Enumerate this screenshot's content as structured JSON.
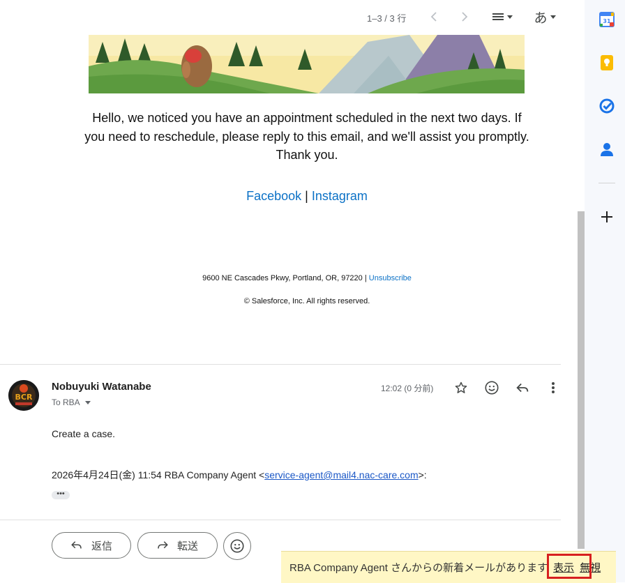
{
  "toolbar": {
    "pager": "1–3 / 3 行",
    "input_tool_label": "あ"
  },
  "email": {
    "message": "Hello, we noticed you have an appointment scheduled in the next two days. If you need to reschedule, please reply to this email, and we'll assist you promptly. Thank you.",
    "social": {
      "facebook": "Facebook",
      "separator": "|",
      "instagram": "Instagram"
    },
    "footer": {
      "address": "9600 NE Cascades Pkwy, Portland, OR, 97220 |",
      "unsubscribe": "Unsubscribe",
      "copyright": "© Salesforce, Inc. All rights reserved."
    }
  },
  "reply_message": {
    "sender_name": "Nobuyuki Watanabe",
    "to_label": "To RBA",
    "time": "12:02 (0 分前)",
    "body": "Create a case.",
    "quote_prefix": "2026年4月24日(金) 11:54 RBA Company Agent <",
    "quote_email": "service-agent@mail4.nac-care.com",
    "quote_suffix": ">:",
    "ellipsis": "•••"
  },
  "actions": {
    "reply": "返信",
    "forward": "転送"
  },
  "notification": {
    "message": "RBA Company Agent さんからの新着メールがあります",
    "show": "表示",
    "ignore": "無視"
  },
  "side_apps": {
    "calendar_date": "31"
  },
  "colors": {
    "link": "#0b71c6",
    "notify_bg": "#fff7c5",
    "highlight": "#d71f1f"
  }
}
